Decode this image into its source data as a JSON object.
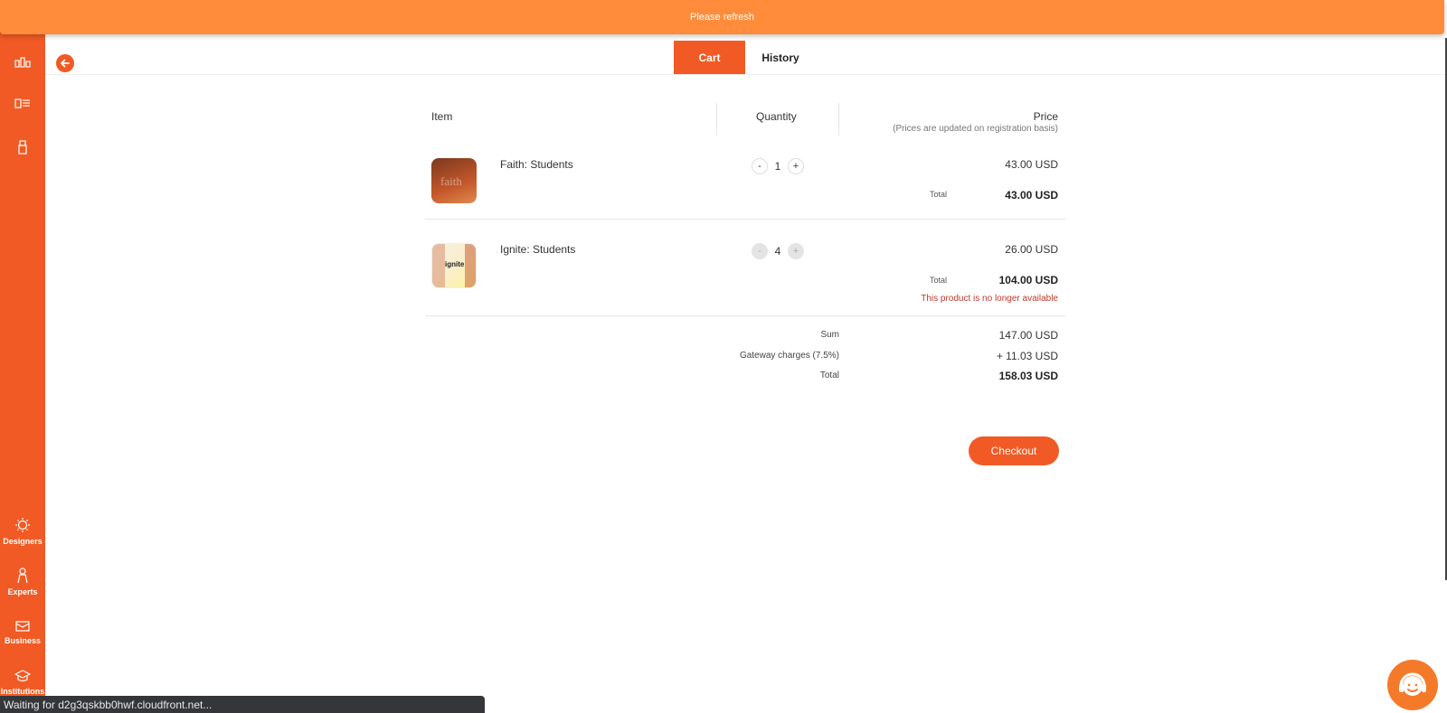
{
  "banner": {
    "text": "Please refresh"
  },
  "tabs": [
    {
      "label": "Cart"
    },
    {
      "label": "History"
    }
  ],
  "table": {
    "headers": {
      "item": "Item",
      "quantity": "Quantity",
      "price": "Price",
      "price_note": "(Prices are updated on registration basis)"
    },
    "rows": [
      {
        "name": "Faith: Students",
        "quantity": "1",
        "unit_price": "43.00 USD",
        "total_label": "Total",
        "total": "43.00 USD",
        "thumb_text": "faith"
      },
      {
        "name": "Ignite: Students",
        "quantity": "4",
        "unit_price": "26.00 USD",
        "total_label": "Total",
        "total": "104.00 USD",
        "warning": "This product is no longer available",
        "thumb_text": "ignite"
      }
    ]
  },
  "summary": {
    "sum_label": "Sum",
    "sum_value": "147.00 USD",
    "gateway_label": "Gateway charges (7.5%)",
    "gateway_value": "+ 11.03 USD",
    "total_label": "Total",
    "total_value": "158.03 USD"
  },
  "checkout": {
    "label": "Checkout"
  },
  "sidebar": {
    "bottom_items": [
      {
        "label": "Designers",
        "icon": "gear-bulb-icon"
      },
      {
        "label": "Experts",
        "icon": "expert-icon"
      },
      {
        "label": "Business",
        "icon": "briefcase-icon"
      },
      {
        "label": "Institutions",
        "icon": "graduation-cap-icon"
      }
    ]
  },
  "qty_controls": {
    "minus": "-",
    "plus": "+"
  },
  "status": {
    "text": "Waiting for d2g3qskbb0hwf.cloudfront.net..."
  },
  "colors": {
    "accent": "#f15a24",
    "banner": "#ff8c3a",
    "warning": "#c0392b"
  }
}
